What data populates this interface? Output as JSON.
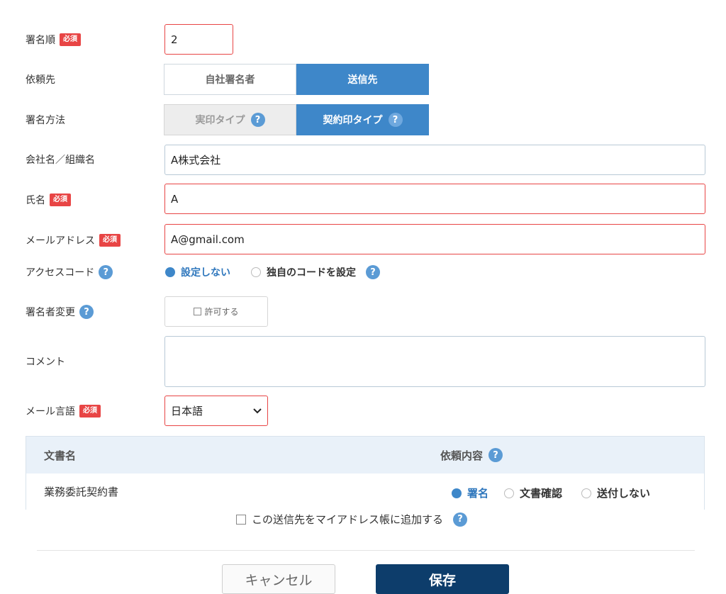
{
  "required_badge": "必須",
  "help_glyph": "?",
  "fields": {
    "signing_order": {
      "label": "署名順",
      "value": "2"
    },
    "recipient_type": {
      "label": "依頼先",
      "options": [
        "自社署名者",
        "送信先"
      ],
      "selected": "送信先"
    },
    "signing_method": {
      "label": "署名方法",
      "options": [
        "実印タイプ",
        "契約印タイプ"
      ],
      "selected": "契約印タイプ"
    },
    "company": {
      "label": "会社名／組織名",
      "value": "A株式会社"
    },
    "name": {
      "label": "氏名",
      "value": "A"
    },
    "email": {
      "label": "メールアドレス",
      "value": "A@gmail.com"
    },
    "access_code": {
      "label": "アクセスコード",
      "options": [
        "設定しない",
        "独自のコードを設定"
      ],
      "selected": "設定しない"
    },
    "signer_change": {
      "label": "署名者変更",
      "checkbox_label": "許可する",
      "checked": false
    },
    "comment": {
      "label": "コメント",
      "value": ""
    },
    "mail_language": {
      "label": "メール言語",
      "value": "日本語"
    }
  },
  "documents": {
    "headers": [
      "文書名",
      "依頼内容"
    ],
    "rows": [
      {
        "name": "業務委託契約書",
        "options": [
          "署名",
          "文書確認",
          "送付しない"
        ],
        "selected": "署名"
      }
    ]
  },
  "address_book": {
    "label": "この送信先をマイアドレス帳に追加する",
    "checked": false
  },
  "buttons": {
    "cancel": "キャンセル",
    "save": "保存"
  },
  "colors": {
    "accent": "#3e87c9",
    "required": "#e84545",
    "save": "#0d3d6b"
  }
}
